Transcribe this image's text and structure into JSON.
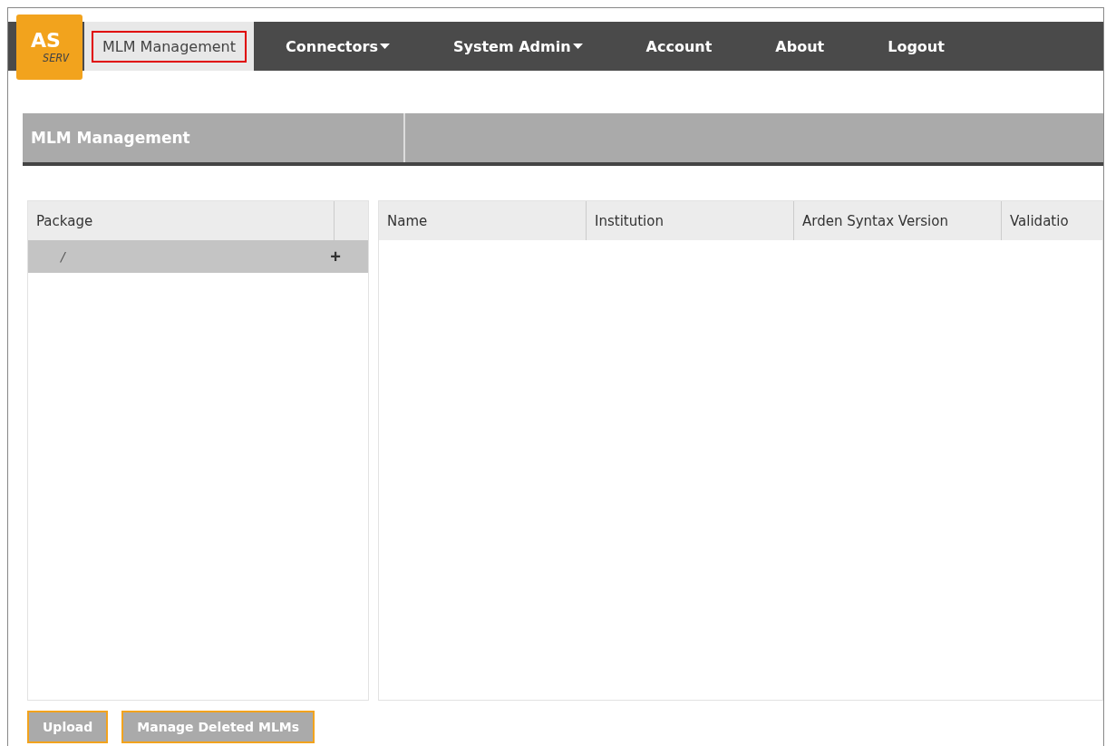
{
  "logo": {
    "main": "AS",
    "sub": "SERV"
  },
  "nav": [
    {
      "label": "MLM Management",
      "selected": true,
      "highlighted": true,
      "dropdown": false
    },
    {
      "label": "Connectors",
      "selected": false,
      "highlighted": false,
      "dropdown": true
    },
    {
      "label": "System Admin",
      "selected": false,
      "highlighted": false,
      "dropdown": true
    },
    {
      "label": "Account",
      "selected": false,
      "highlighted": false,
      "dropdown": false
    },
    {
      "label": "About",
      "selected": false,
      "highlighted": false,
      "dropdown": false
    },
    {
      "label": "Logout",
      "selected": false,
      "highlighted": false,
      "dropdown": false
    }
  ],
  "section_title": "MLM Management",
  "package_panel": {
    "column": "Package",
    "rows": [
      {
        "label": "/",
        "action": "+",
        "selected": true
      }
    ]
  },
  "mlm_table": {
    "columns": [
      "Name",
      "Institution",
      "Arden Syntax Version",
      "Validatio"
    ]
  },
  "buttons": [
    "Upload",
    "Manage Deleted MLMs"
  ]
}
